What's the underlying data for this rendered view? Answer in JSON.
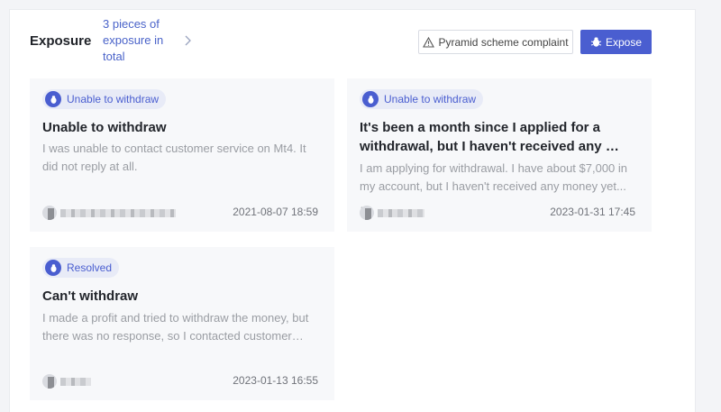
{
  "header": {
    "title": "Exposure",
    "count_text": "3 pieces of exposure in total",
    "complaint_label": "Pyramid scheme complaint",
    "expose_label": "Expose"
  },
  "cards": [
    {
      "badge": "Unable to withdraw",
      "title": "Unable to withdraw",
      "description": "I was unable to contact customer service on Mt4. It did not reply at all.",
      "time": "2021-08-07 18:59"
    },
    {
      "badge": "Unable to withdraw",
      "title": "It's been a month since I applied for a withdrawal, but I haven't received any …",
      "description": "I am applying for withdrawal. I have about $7,000 in my account, but I haven't received any money yet... …",
      "time": "2023-01-31 17:45"
    },
    {
      "badge": "Resolved",
      "title": "Can't withdraw",
      "description": "I made a profit and tried to withdraw the money, but there was no response, so I contacted customer…",
      "time": "2023-01-13 16:55"
    }
  ],
  "colors": {
    "accent": "#4a5ed0",
    "link": "#4a63c9",
    "card_bg": "#f7f8fa",
    "page_bg": "#f3f4f7"
  },
  "icons": {
    "chevron": "chevron-right-icon",
    "warning": "warning-triangle-icon",
    "expose": "bug-icon",
    "badge": "bug-icon"
  }
}
